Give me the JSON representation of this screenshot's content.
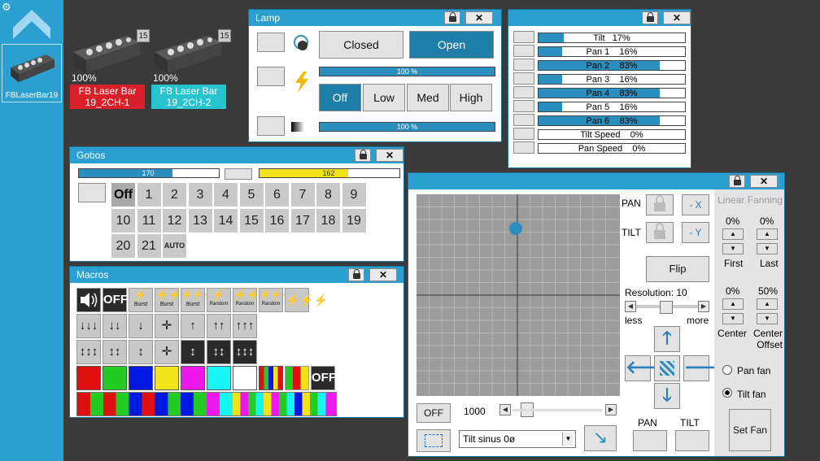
{
  "sidebar": {
    "gear_icon": "gear-icon",
    "device_label": "FBLaserBar19"
  },
  "fixtures": [
    {
      "number": "15",
      "percent": "100%",
      "name_line1": "FB Laser Bar",
      "name_line2": "19_2CH-1",
      "color": "#d9202a"
    },
    {
      "number": "15",
      "percent": "100%",
      "name_line1": "FB Laser Bar",
      "name_line2": "19_2CH-2",
      "color": "#27c3cf"
    }
  ],
  "lamp": {
    "title": "Lamp",
    "closed": "Closed",
    "open": "Open",
    "bar1": "100 %",
    "bar2": "100 %",
    "levels": [
      "Off",
      "Low",
      "Med",
      "High"
    ]
  },
  "pan_tilt_list": {
    "rows": [
      {
        "label": "Tilt   17%",
        "value": 17
      },
      {
        "label": "Pan 1    16%",
        "value": 16
      },
      {
        "label": "Pan 2    83%",
        "value": 83
      },
      {
        "label": "Pan 3    16%",
        "value": 16
      },
      {
        "label": "Pan 4    83%",
        "value": 83
      },
      {
        "label": "Pan 5    16%",
        "value": 16
      },
      {
        "label": "Pan 6    83%",
        "value": 83
      },
      {
        "label": "Tilt Speed    0%",
        "value": 0
      },
      {
        "label": "Pan Speed    0%",
        "value": 0
      }
    ]
  },
  "gobos": {
    "title": "Gobos",
    "bar1": "170",
    "bar1_value": 170,
    "bar2": "162",
    "bar2_value": 162,
    "cells": [
      "Off",
      "1",
      "2",
      "3",
      "4",
      "5",
      "6",
      "7",
      "8",
      "9",
      "10",
      "11",
      "12",
      "13",
      "14",
      "15",
      "16",
      "17",
      "18",
      "19",
      "20",
      "21",
      "AUTO"
    ]
  },
  "macros": {
    "title": "Macros",
    "row1": [
      "",
      "OFF",
      "Burst",
      "Burst",
      "Burst",
      "Random",
      "Random",
      "Random",
      ""
    ],
    "off2": "OFF",
    "colors": [
      "#e01010",
      "#22cc22",
      "#0018e0",
      "#f2e21a",
      "#ef18ef",
      "#18f4f4",
      "#ffffff"
    ]
  },
  "position": {
    "pan_label": "PAN",
    "tilt_label": "TILT",
    "minus_x": "- X",
    "minus_y": "- Y",
    "flip": "Flip",
    "resolution": "Resolution: 10",
    "less": "less",
    "more": "more",
    "off": "OFF",
    "speed": "1000",
    "effect": "Tilt sinus 0ø",
    "pan_btn": "PAN",
    "tilt_btn": "TILT",
    "fanning_title": "Linear Fanning",
    "first_pct": "0%",
    "last_pct": "0%",
    "first": "First",
    "last": "Last",
    "center_pct": "0%",
    "offset_pct": "50%",
    "center": "Center",
    "center_offset_1": "Center",
    "center_offset_2": "Offset",
    "pan_fan": "Pan fan",
    "tilt_fan": "Tilt fan",
    "set_fan": "Set Fan"
  }
}
